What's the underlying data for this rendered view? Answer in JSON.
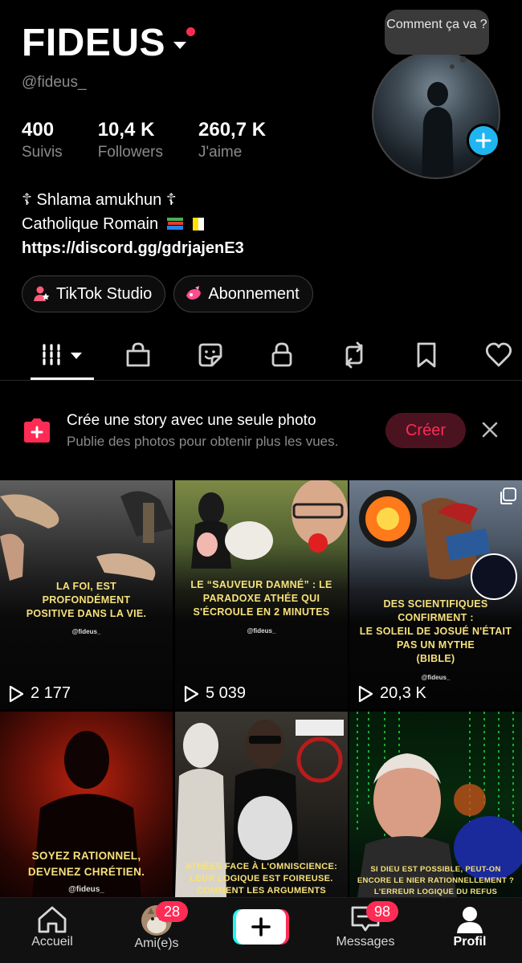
{
  "profile": {
    "username": "FIDEUS",
    "handle": "@fideus_",
    "bubble_text": "Comment ça va ?",
    "stats": [
      {
        "value": "400",
        "label": "Suivis"
      },
      {
        "value": "10,4 K",
        "label": "Followers"
      },
      {
        "value": "260,7 K",
        "label": "J'aime"
      }
    ],
    "bio_line1": "☦ Shlama amukhun ☦",
    "bio_line2": " Catholique Romain",
    "bio_link": "https://discord.gg/gdrjajenE3"
  },
  "buttons": {
    "studio": "TikTok Studio",
    "subscription": "Abonnement"
  },
  "story_prompt": {
    "title": "Crée une story avec une seule photo",
    "subtitle": "Publie des photos pour obtenir plus les vues.",
    "button": "Créer"
  },
  "videos": [
    {
      "caption": "LA FOI, EST\nPROFONDÉMENT\nPOSITIVE DANS LA VIE.",
      "tag": "@fideus_",
      "views": "2 177"
    },
    {
      "caption": "LE “SAUVEUR DAMNÉ” : LE\nPARADOXE ATHÉE QUI\nS'ÉCROULE EN 2 MINUTES",
      "tag": "@fideus_",
      "views": "5 039"
    },
    {
      "caption": "DES SCIENTIFIQUES\nCONFIRMENT :\nLE SOLEIL DE JOSUÉ N'ÉTAIT\nPAS UN MYTHE\n(BIBLE)",
      "tag": "@fideus_",
      "views": "20,3 K"
    },
    {
      "caption": "SOYEZ RATIONNEL,\nDEVENEZ CHRÉTIEN.",
      "tag": "@fideus_",
      "views": ""
    },
    {
      "caption": "ATHÉES FACE À L'OMNISCIENCE:\nLEUR LOGIQUE EST FOIREUSE.\nCOMMENT LES ARGUMENTS\nCONTRE DIEU S'EFFONDRENT EN",
      "tag": "",
      "views": ""
    },
    {
      "caption": "SI DIEU EST POSSIBLE, PEUT-ON\nENCORE LE NIER RATIONNELLEMENT ?\nL'ERREUR LOGIQUE DU REFUS\nCATÉGORIQUE DE DIEU (PLANTINGA)",
      "tag": "",
      "views": ""
    }
  ],
  "bottom_nav": {
    "home": "Accueil",
    "friends": "Ami(e)s",
    "friends_badge": "28",
    "messages": "Messages",
    "messages_badge": "98",
    "profile": "Profil"
  },
  "colors": {
    "accent": "#fe2c55",
    "plus_blue": "#20b5f0",
    "caption_yellow": "#f7e17a"
  }
}
